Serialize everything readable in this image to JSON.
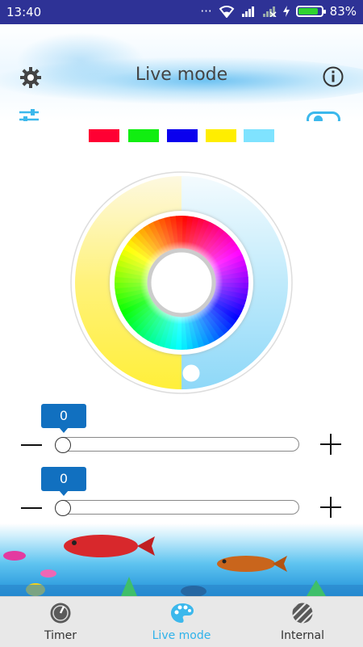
{
  "status_bar": {
    "time": "13:40",
    "battery_text": "83%",
    "icons": [
      "dots-icon",
      "wifi-icon",
      "signal-icon",
      "no-signal-icon",
      "charging-icon",
      "battery-icon"
    ]
  },
  "header": {
    "title": "Live mode",
    "left_icon": "gear-icon",
    "right_icon": "info-icon",
    "secondary_left_icon": "sliders-icon",
    "secondary_right_icon": "toggle-icon",
    "toggle_state": "off"
  },
  "colors": {
    "status_bar": "#2e3296",
    "accent": "#2fb2ea",
    "slider_bubble": "#1170c0",
    "swatches": [
      "#ff0033",
      "#11ee11",
      "#0a00ee",
      "#ffee00",
      "#7fe3ff"
    ]
  },
  "color_wheel": {
    "outer_ring_left": "warm-yellow",
    "outer_ring_right": "cool-cyan",
    "inner_ring": "rgb-hue-wheel"
  },
  "sliders": [
    {
      "value": "0",
      "minus_icon": "minus-icon",
      "plus_icon": "plus-icon"
    },
    {
      "value": "0",
      "minus_icon": "minus-icon",
      "plus_icon": "plus-icon"
    }
  ],
  "nav": {
    "items": [
      {
        "label": "Timer",
        "icon": "timer-icon",
        "active": false
      },
      {
        "label": "Live mode",
        "icon": "palette-icon",
        "active": true
      },
      {
        "label": "Internal",
        "icon": "striped-circle-icon",
        "active": false
      }
    ]
  }
}
